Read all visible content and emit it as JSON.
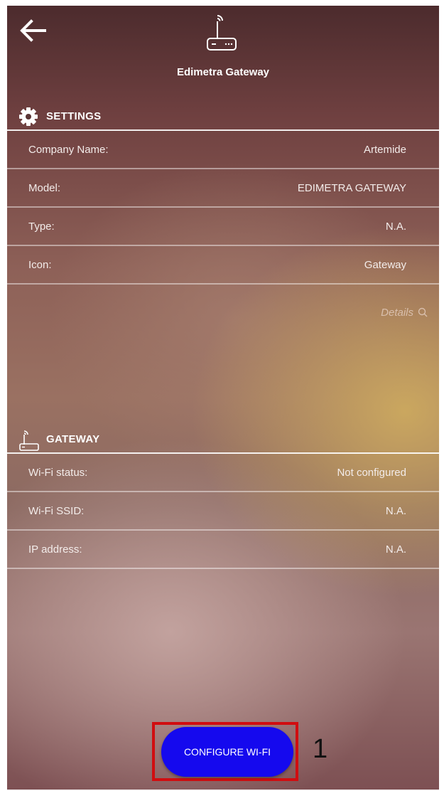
{
  "header": {
    "title": "Edimetra Gateway",
    "back_icon": "arrow-left-icon",
    "device_icon": "router-icon"
  },
  "settings": {
    "title": "SETTINGS",
    "icon": "gear-icon",
    "rows": [
      {
        "label": "Company Name:",
        "value": "Artemide"
      },
      {
        "label": "Model:",
        "value": "EDIMETRA GATEWAY"
      },
      {
        "label": "Type:",
        "value": "N.A."
      },
      {
        "label": "Icon:",
        "value": "Gateway"
      }
    ],
    "details_label": "Details"
  },
  "gateway": {
    "title": "GATEWAY",
    "icon": "router-icon",
    "rows": [
      {
        "label": "Wi-Fi status:",
        "value": "Not configured"
      },
      {
        "label": "Wi-Fi SSID:",
        "value": "N.A."
      },
      {
        "label": "IP address:",
        "value": "N.A."
      }
    ]
  },
  "action": {
    "configure_label": "CONFIGURE WI-FI",
    "button_color": "#1509ee"
  },
  "annotation": {
    "label": "1",
    "box_color": "#d10d10"
  }
}
